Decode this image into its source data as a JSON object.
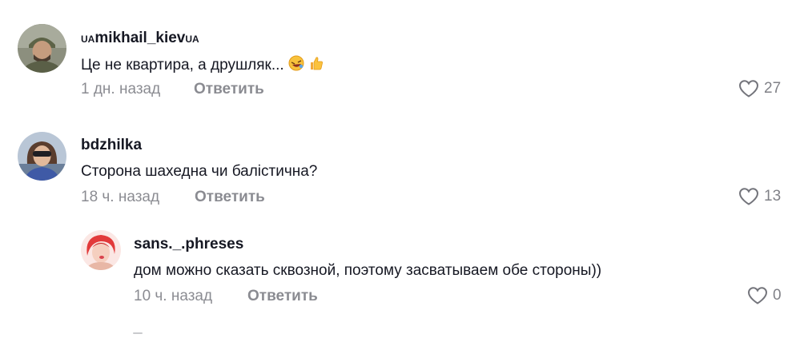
{
  "comments": [
    {
      "flag_prefix": "UA",
      "username": "mikhail_kiev",
      "flag_suffix": "UA",
      "text": "Це не квартира, а друшляк...",
      "time": "1 дн. назад",
      "reply_label": "Ответить",
      "likes": "27"
    },
    {
      "username": "bdzhilka",
      "text": "Сторона шахедна чи балістична?",
      "time": "18 ч. назад",
      "reply_label": "Ответить",
      "likes": "13"
    }
  ],
  "reply": {
    "username": "sans._.phreses",
    "text": "дом можно сказать сквозной, поэтому засватываем обе стороны))",
    "time": "10 ч. назад",
    "reply_label": "Ответить",
    "likes": "0"
  },
  "colors": {
    "primary_text": "#161823",
    "secondary_text": "#8a8b91"
  },
  "icons": {
    "like": "heart-outline-icon",
    "emoji_1": "rolling-on-floor-laughing-emoji",
    "emoji_2": "thumbs-up-emoji"
  }
}
